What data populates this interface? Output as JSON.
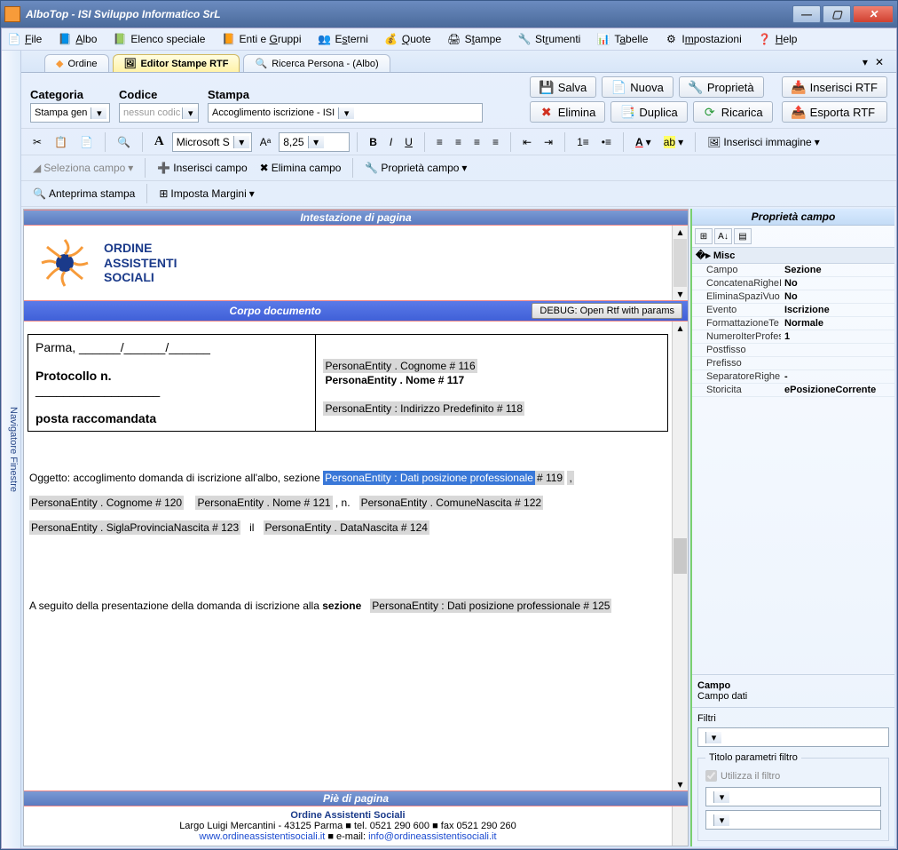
{
  "window": {
    "title": "AlboTop - ISI Sviluppo Informatico SrL"
  },
  "menu": {
    "file": "File",
    "albo": "Albo",
    "elenco": "Elenco speciale",
    "enti": "Enti e Gruppi",
    "esterni": "Esterni",
    "quote": "Quote",
    "stampe": "Stampe",
    "strumenti": "Strumenti",
    "tabelle": "Tabelle",
    "impostazioni": "Impostazioni",
    "help": "Help"
  },
  "leftrail": "Navigatore Finestre",
  "tabs": {
    "t1": "Ordine",
    "t2": "Editor Stampe RTF",
    "t3": "Ricerca Persona - (Albo)"
  },
  "ribbon": {
    "categoria_lbl": "Categoria",
    "categoria_val": "Stampa gen",
    "codice_lbl": "Codice",
    "codice_val": "nessun codic",
    "stampa_lbl": "Stampa",
    "stampa_val": "Accoglimento iscrizione - ISI",
    "salva": "Salva",
    "nuova": "Nuova",
    "proprieta": "Proprietà",
    "ins_rtf": "Inserisci RTF",
    "elimina": "Elimina",
    "duplica": "Duplica",
    "ricarica": "Ricarica",
    "exp_rtf": "Esporta RTF"
  },
  "fmt": {
    "font": "Microsoft S",
    "size": "8,25",
    "seleziona": "Seleziona campo",
    "inserisci": "Inserisci campo",
    "elimina": "Elimina campo",
    "proprieta": "Proprietà campo",
    "ins_img": "Inserisci immagine",
    "anteprima": "Anteprima stampa",
    "margini": "Imposta Margini"
  },
  "sections": {
    "header": "Intestazione di pagina",
    "corpo": "Corpo documento",
    "debug": "DEBUG: Open Rtf with params",
    "footer": "Piè di pagina"
  },
  "org": {
    "l1": "ORDINE",
    "l2": "ASSISTENTI",
    "l3": "SOCIALI"
  },
  "letter": {
    "parma": "Parma, ______/______/______",
    "protocollo": "Protocollo n.",
    "line": "__________________",
    "posta": "posta raccomandata",
    "cognome": "PersonaEntity . Cognome # 116",
    "nome": "PersonaEntity . Nome # 117",
    "indirizzo": "PersonaEntity : Indirizzo Predefinito # 118",
    "oggetto_pre": "Oggetto: accoglimento domanda di iscrizione all'albo, sezione",
    "dati_pos": "PersonaEntity : Dati posizione professionale",
    "n119": "# 119",
    "cognome120": "PersonaEntity . Cognome # 120",
    "nome121": "PersonaEntity . Nome # 121",
    "virg_n": ", n.",
    "comune122": "PersonaEntity . ComuneNascita # 122",
    "sigla123": "PersonaEntity . SiglaProvinciaNascita # 123",
    "il": "il",
    "data124": "PersonaEntity . DataNascita # 124",
    "seguito": "A seguito della presentazione della domanda di iscrizione alla",
    "sezione": "sezione",
    "dati125": "PersonaEntity : Dati posizione professionale # 125"
  },
  "footer": {
    "org": "Ordine Assistenti Sociali",
    "addr": "Largo Luigi Mercantini - 43125 Parma ■ tel. 0521 290 600 ■ fax 0521 290 260",
    "web": "www.ordineassistentisociali.it",
    "mail_lbl": " ■ e-mail: ",
    "mail": "info@ordineassistentisociali.it"
  },
  "rpanel": {
    "title": "Proprietà campo",
    "cat": "Misc",
    "rows": {
      "Campo": "Sezione",
      "ConcatenaRigheI": "No",
      "EliminaSpaziVuo": "No",
      "Evento": "Iscrizione",
      "FormattazioneTe": "Normale",
      "NumeroIterProfes": "1",
      "Postfisso": "",
      "Prefisso": "",
      "SeparatoreRighe": "-",
      "Storicita": "ePosizioneCorrente"
    },
    "desc_t": "Campo",
    "desc_b": "Campo dati",
    "filtri": "Filtri",
    "titolo_param": "Titolo parametri filtro",
    "usa_filtro": "Utilizza il filtro"
  }
}
